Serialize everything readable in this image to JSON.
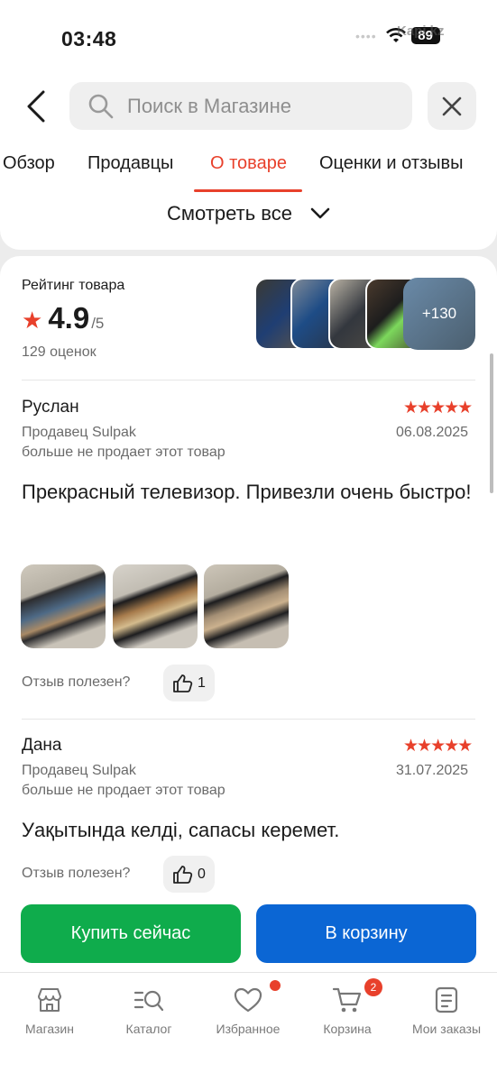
{
  "status": {
    "time": "03:48",
    "battery": "89",
    "watermark": "Kapi.kz"
  },
  "search": {
    "placeholder": "Поиск в Магазине"
  },
  "tabs": [
    {
      "label": "Обзор"
    },
    {
      "label": "Продавцы"
    },
    {
      "label": "О товаре",
      "active": true
    },
    {
      "label": "Оценки и отзывы"
    }
  ],
  "see_all": "Смотреть все",
  "rating": {
    "label": "Рейтинг товара",
    "value": "4.9",
    "scale": "/5",
    "count": "129 оценок",
    "more_photos": "+130"
  },
  "reviews": [
    {
      "author": "Руслан",
      "stars": 5,
      "seller": "Продавец Sulpak",
      "date": "06.08.2025",
      "note": "больше не продает этот товар",
      "text": "Прекрасный телевизор. Привезли очень быстро!",
      "helpful_label": "Отзыв полезен?",
      "likes": "1"
    },
    {
      "author": "Дана",
      "stars": 5,
      "seller": "Продавец Sulpak",
      "date": "31.07.2025",
      "note": "больше не продает этот товар",
      "text": "Уақытында келді, сапасы керемет.",
      "helpful_label": "Отзыв полезен?",
      "likes": "0"
    }
  ],
  "actions": {
    "buy": "Купить сейчас",
    "cart": "В корзину"
  },
  "nav": [
    {
      "label": "Магазин",
      "icon": "shop-icon"
    },
    {
      "label": "Каталог",
      "icon": "catalog-search-icon"
    },
    {
      "label": "Избранное",
      "icon": "heart-icon"
    },
    {
      "label": "Корзина",
      "icon": "cart-icon",
      "badge": "2"
    },
    {
      "label": "Мои заказы",
      "icon": "orders-icon"
    }
  ],
  "colors": {
    "accent": "#e8402b",
    "buy": "#0fac4c",
    "cart": "#0b66d4"
  }
}
